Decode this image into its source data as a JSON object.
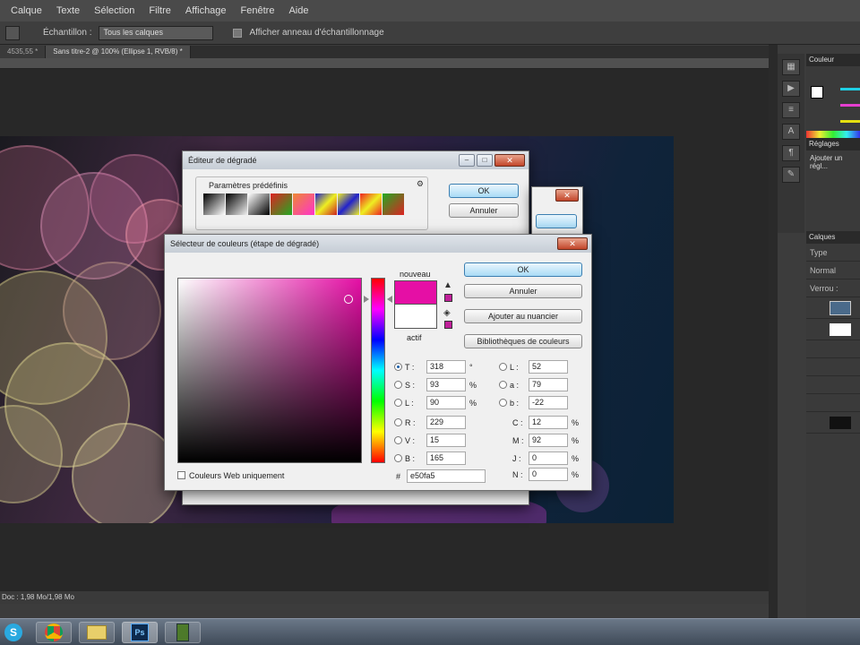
{
  "menubar": {
    "items": [
      "Calque",
      "Texte",
      "Sélection",
      "Filtre",
      "Affichage",
      "Fenêtre",
      "Aide"
    ]
  },
  "optionsbar": {
    "sample_label": "Échantillon :",
    "sample_value": "Tous les calques",
    "show_ring_label": "Afficher anneau d'échantillonnage"
  },
  "doc_tabs": [
    "4535,55 *",
    "Sans titre-2 @ 100% (Ellipse 1, RVB/8) *"
  ],
  "status": {
    "doc_size": "Doc : 1,98 Mo/1,98 Mo"
  },
  "gradient_editor": {
    "title": "Éditeur de dégradé",
    "presets_label": "Paramètres prédéfinis",
    "ok_label": "OK",
    "cancel_label": "Annuler"
  },
  "color_picker": {
    "title": "Sélecteur de couleurs (étape de dégradé)",
    "new_label": "nouveau",
    "current_label": "actif",
    "ok_label": "OK",
    "cancel_label": "Annuler",
    "add_swatch_label": "Ajouter au nuancier",
    "libraries_label": "Bibliothèques de couleurs",
    "web_only_label": "Couleurs Web uniquement",
    "new_color": "#e50fa5",
    "current_color": "#ffffff",
    "hsb": [
      {
        "label": "T :",
        "value": "318",
        "unit": "°"
      },
      {
        "label": "S :",
        "value": "93",
        "unit": "%"
      },
      {
        "label": "L :",
        "value": "90",
        "unit": "%"
      }
    ],
    "rgb": [
      {
        "label": "R :",
        "value": "229"
      },
      {
        "label": "V :",
        "value": "15"
      },
      {
        "label": "B :",
        "value": "165"
      }
    ],
    "lab": [
      {
        "label": "L :",
        "value": "52"
      },
      {
        "label": "a :",
        "value": "79"
      },
      {
        "label": "b :",
        "value": "-22"
      }
    ],
    "cmyk": [
      {
        "label": "C :",
        "value": "12",
        "unit": "%"
      },
      {
        "label": "M :",
        "value": "92",
        "unit": "%"
      },
      {
        "label": "J :",
        "value": "0",
        "unit": "%"
      },
      {
        "label": "N :",
        "value": "0",
        "unit": "%"
      }
    ],
    "hex_label": "#",
    "hex_value": "e50fa5"
  },
  "panels": {
    "color_tab": "Couleur",
    "adjust_tab": "Réglages",
    "adjust_text": "Ajouter un régl...",
    "layers_tab": "Calques",
    "kind": "Type",
    "blend": "Normal",
    "lock": "Verrou :"
  },
  "colors": {
    "accent": "#e50fa5",
    "ui_dark": "#3c3c3c"
  }
}
